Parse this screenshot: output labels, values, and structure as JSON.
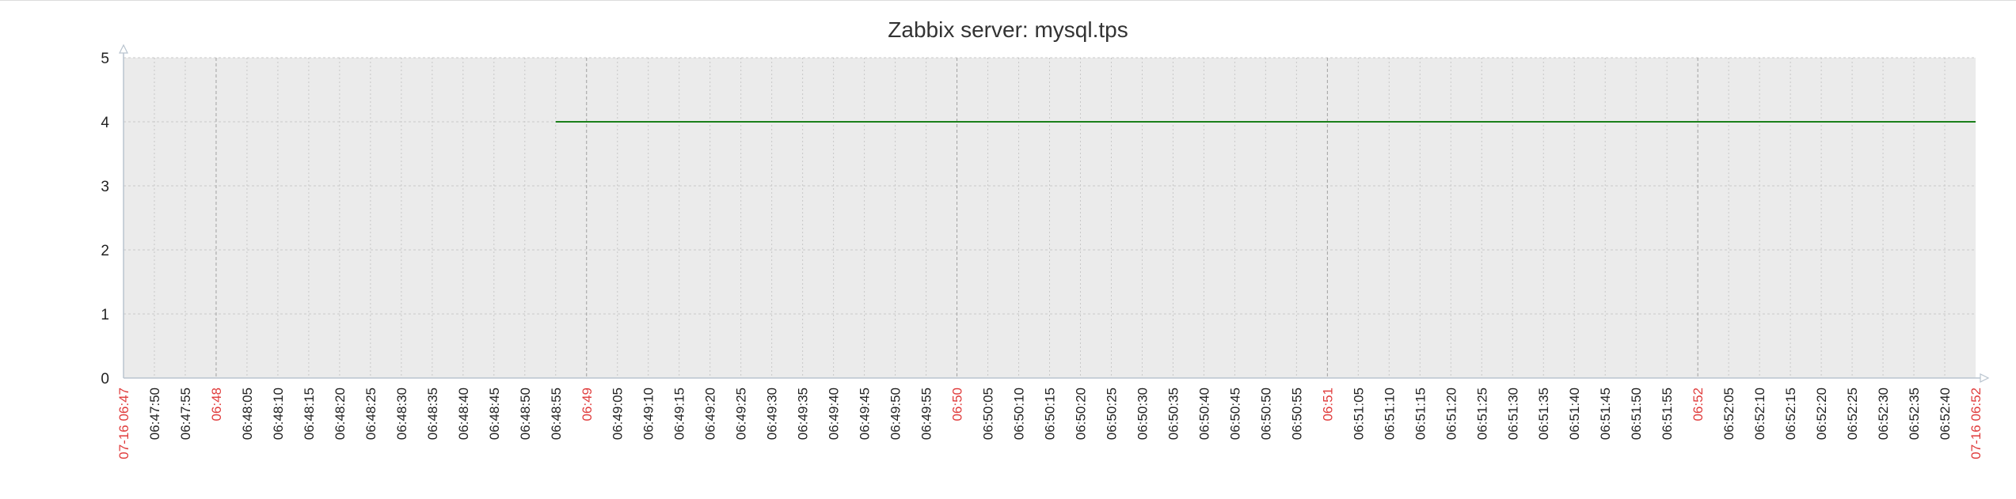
{
  "chart_data": {
    "type": "line",
    "title": "Zabbix server: mysql.tps",
    "xlabel": "",
    "ylabel": "",
    "ylim": [
      0,
      5
    ],
    "y_ticks": [
      "0",
      "1",
      "2",
      "3",
      "4",
      "5"
    ],
    "grid": true,
    "x_start": "06:47:45",
    "x_end": "06:52:45",
    "x_ticks": [
      {
        "time": "06:47:45",
        "label": "07-16 06:47",
        "major": true
      },
      {
        "time": "06:47:50",
        "label": "06:47:50",
        "major": false
      },
      {
        "time": "06:47:55",
        "label": "06:47:55",
        "major": false
      },
      {
        "time": "06:48:00",
        "label": "06:48",
        "major": true
      },
      {
        "time": "06:48:05",
        "label": "06:48:05",
        "major": false
      },
      {
        "time": "06:48:10",
        "label": "06:48:10",
        "major": false
      },
      {
        "time": "06:48:15",
        "label": "06:48:15",
        "major": false
      },
      {
        "time": "06:48:20",
        "label": "06:48:20",
        "major": false
      },
      {
        "time": "06:48:25",
        "label": "06:48:25",
        "major": false
      },
      {
        "time": "06:48:30",
        "label": "06:48:30",
        "major": false
      },
      {
        "time": "06:48:35",
        "label": "06:48:35",
        "major": false
      },
      {
        "time": "06:48:40",
        "label": "06:48:40",
        "major": false
      },
      {
        "time": "06:48:45",
        "label": "06:48:45",
        "major": false
      },
      {
        "time": "06:48:50",
        "label": "06:48:50",
        "major": false
      },
      {
        "time": "06:48:55",
        "label": "06:48:55",
        "major": false
      },
      {
        "time": "06:49:00",
        "label": "06:49",
        "major": true
      },
      {
        "time": "06:49:05",
        "label": "06:49:05",
        "major": false
      },
      {
        "time": "06:49:10",
        "label": "06:49:10",
        "major": false
      },
      {
        "time": "06:49:15",
        "label": "06:49:15",
        "major": false
      },
      {
        "time": "06:49:20",
        "label": "06:49:20",
        "major": false
      },
      {
        "time": "06:49:25",
        "label": "06:49:25",
        "major": false
      },
      {
        "time": "06:49:30",
        "label": "06:49:30",
        "major": false
      },
      {
        "time": "06:49:35",
        "label": "06:49:35",
        "major": false
      },
      {
        "time": "06:49:40",
        "label": "06:49:40",
        "major": false
      },
      {
        "time": "06:49:45",
        "label": "06:49:45",
        "major": false
      },
      {
        "time": "06:49:50",
        "label": "06:49:50",
        "major": false
      },
      {
        "time": "06:49:55",
        "label": "06:49:55",
        "major": false
      },
      {
        "time": "06:50:00",
        "label": "06:50",
        "major": true
      },
      {
        "time": "06:50:05",
        "label": "06:50:05",
        "major": false
      },
      {
        "time": "06:50:10",
        "label": "06:50:10",
        "major": false
      },
      {
        "time": "06:50:15",
        "label": "06:50:15",
        "major": false
      },
      {
        "time": "06:50:20",
        "label": "06:50:20",
        "major": false
      },
      {
        "time": "06:50:25",
        "label": "06:50:25",
        "major": false
      },
      {
        "time": "06:50:30",
        "label": "06:50:30",
        "major": false
      },
      {
        "time": "06:50:35",
        "label": "06:50:35",
        "major": false
      },
      {
        "time": "06:50:40",
        "label": "06:50:40",
        "major": false
      },
      {
        "time": "06:50:45",
        "label": "06:50:45",
        "major": false
      },
      {
        "time": "06:50:50",
        "label": "06:50:50",
        "major": false
      },
      {
        "time": "06:50:55",
        "label": "06:50:55",
        "major": false
      },
      {
        "time": "06:51:00",
        "label": "06:51",
        "major": true
      },
      {
        "time": "06:51:05",
        "label": "06:51:05",
        "major": false
      },
      {
        "time": "06:51:10",
        "label": "06:51:10",
        "major": false
      },
      {
        "time": "06:51:15",
        "label": "06:51:15",
        "major": false
      },
      {
        "time": "06:51:20",
        "label": "06:51:20",
        "major": false
      },
      {
        "time": "06:51:25",
        "label": "06:51:25",
        "major": false
      },
      {
        "time": "06:51:30",
        "label": "06:51:30",
        "major": false
      },
      {
        "time": "06:51:35",
        "label": "06:51:35",
        "major": false
      },
      {
        "time": "06:51:40",
        "label": "06:51:40",
        "major": false
      },
      {
        "time": "06:51:45",
        "label": "06:51:45",
        "major": false
      },
      {
        "time": "06:51:50",
        "label": "06:51:50",
        "major": false
      },
      {
        "time": "06:51:55",
        "label": "06:51:55",
        "major": false
      },
      {
        "time": "06:52:00",
        "label": "06:52",
        "major": true
      },
      {
        "time": "06:52:05",
        "label": "06:52:05",
        "major": false
      },
      {
        "time": "06:52:10",
        "label": "06:52:10",
        "major": false
      },
      {
        "time": "06:52:15",
        "label": "06:52:15",
        "major": false
      },
      {
        "time": "06:52:20",
        "label": "06:52:20",
        "major": false
      },
      {
        "time": "06:52:25",
        "label": "06:52:25",
        "major": false
      },
      {
        "time": "06:52:30",
        "label": "06:52:30",
        "major": false
      },
      {
        "time": "06:52:35",
        "label": "06:52:35",
        "major": false
      },
      {
        "time": "06:52:40",
        "label": "06:52:40",
        "major": false
      },
      {
        "time": "06:52:45",
        "label": "07-16 06:52",
        "major": true
      }
    ],
    "series": [
      {
        "color": "#1a7f1a",
        "points": [
          {
            "x": "06:48:55",
            "y": 4
          },
          {
            "x": "06:52:45",
            "y": 4
          }
        ]
      }
    ]
  },
  "colors": {
    "plot_background": "#ebebeb",
    "grid": "#c8c8c8",
    "major_grid": "#a0a0a0",
    "axis": "#b9c4cf",
    "major_tick_label": "#e03c3c",
    "minor_tick_label": "#222222",
    "title": "#333333"
  }
}
